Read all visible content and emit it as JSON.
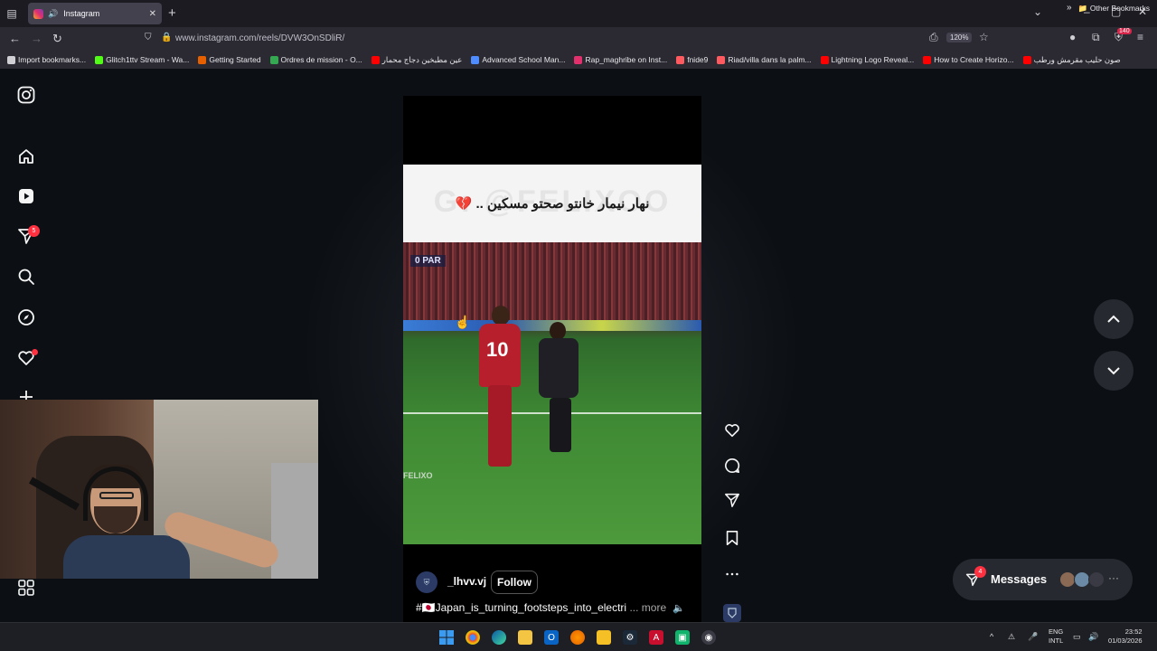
{
  "browser": {
    "tab_title": "Instagram",
    "url": "www.instagram.com/reels/DVW3OnSDliR/",
    "zoom": "120%",
    "extension_badge": "140",
    "bookmarks": [
      {
        "label": "Import bookmarks...",
        "color": "#cfcfd4"
      },
      {
        "label": "Glitch1ttv Stream - Wa...",
        "color": "#53fc18"
      },
      {
        "label": "Getting Started",
        "color": "#e66000"
      },
      {
        "label": "Ordres de mission - O...",
        "color": "#35a852"
      },
      {
        "label": "عين مطبخين دجاج محمار",
        "color": "#ff0000"
      },
      {
        "label": "Advanced School Man...",
        "color": "#4f8cff"
      },
      {
        "label": "Rap_maghribe on Inst...",
        "color": "#e1306c"
      },
      {
        "label": "fnide9",
        "color": "#ff5a5f"
      },
      {
        "label": "Riad/villa dans la palm...",
        "color": "#ff5a5f"
      },
      {
        "label": "Lightning Logo Reveal...",
        "color": "#ff0000"
      },
      {
        "label": "How to Create Horizo...",
        "color": "#ff0000"
      },
      {
        "label": "صون حليب مقرمش ورطب",
        "color": "#ff0000"
      }
    ],
    "other_bookmarks": "Other Bookmarks"
  },
  "sidebar": {
    "notifications_count": "5"
  },
  "reel": {
    "caption_arabic": "نهار نيمار خانتو صحتو مسكين .. 💔",
    "watermark": "G: @FELIXOO",
    "scoreboard": "0  PAR",
    "player_number": "10",
    "felixo_tag": "FELIXO",
    "username": "_lhvv.vj",
    "follow_label": "Follow",
    "description": "#🇯🇵Japan_is_turning_footsteps_into_electri",
    "more_label": "... more"
  },
  "messages": {
    "label": "Messages",
    "badge": "4"
  },
  "taskbar": {
    "lang_top": "ENG",
    "lang_bottom": "INTL",
    "time": "23:52",
    "date": "01/03/2026"
  }
}
